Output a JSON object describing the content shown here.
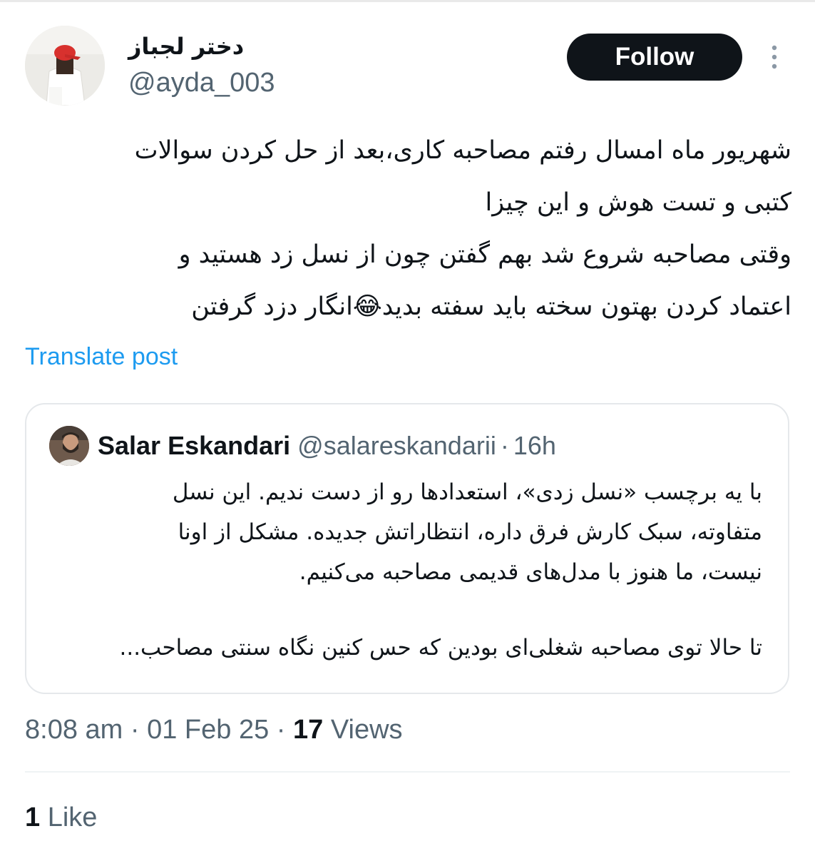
{
  "author": {
    "display_name": "دختر لجباز",
    "handle": "@ayda_003"
  },
  "follow_label": "Follow",
  "more_icon": "more-vertical-icon",
  "tweet": {
    "lines": [
      "شهریور ماه امسال رفتم مصاحبه کاری،بعد از حل کردن سوالات",
      "کتبی و تست هوش و این چیزا",
      "وقتی مصاحبه شروع شد بهم گفتن چون از نسل زد هستید و",
      "اعتماد کردن بهتون سخته باید سفته بدید😂انگار دزد گرفتن"
    ]
  },
  "translate_label": "Translate post",
  "quote": {
    "name": "Salar Eskandari",
    "handle": "@salareskandarii",
    "separator": "·",
    "time": "16h",
    "lines": [
      "با یه برچسب «نسل زدی»، استعدادها رو از دست ندیم. این نسل",
      "متفاوته، سبک کارش فرق داره، انتظاراتش جدیده. مشکل از اونا",
      "نیست، ما هنوز با مدل‌های قدیمی مصاحبه می‌کنیم."
    ],
    "last_line": "تا حالا توی مصاحبه شغلی‌ای بودین که حس کنین نگاه سنتی مصاحب..."
  },
  "meta": {
    "time": "8:08 am",
    "dot1": "·",
    "date": "01 Feb 25",
    "dot2": "·",
    "views_count": "17",
    "views_label": "Views"
  },
  "likes": {
    "count": "1",
    "label": "Like"
  },
  "colors": {
    "text": "#0f1419",
    "secondary": "#536471",
    "link": "#1d9bf0",
    "button_bg": "#0f1419",
    "border": "#e5e8eb"
  }
}
